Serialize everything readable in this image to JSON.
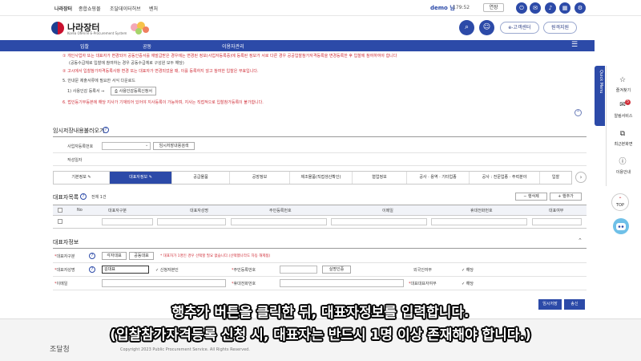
{
  "topbar": {
    "links": [
      "나라장터",
      "종합쇼핑몰",
      "조달데이터허브",
      "벤처"
    ],
    "user_name": "demo 님",
    "timer": "179:52",
    "extend_label": "연장",
    "icons": [
      "logout-icon",
      "mail-icon",
      "bell-icon",
      "grid-icon",
      "settings-icon"
    ]
  },
  "header": {
    "logo_text": "나라장터",
    "logo_sub": "Korea ON-line E-Procurement System",
    "buttons": {
      "customer_center": "e-고객센터",
      "remote_support": "원격지원"
    }
  },
  "nav": {
    "items": [
      "입찰",
      "공동",
      "이용자관리"
    ]
  },
  "notice": {
    "line1": "① 개인사업자 또는 대표자가 변경되어 공동인증서를 재발급받은 경우에는 변경된 정보(사업자등록증)에 등록된 정보가 서로 다른 경우 공공입찰참가자격등록을 변경등록한 후 입찰에 참여하여야 합니다",
    "line2": "(공동수급체로 입찰에 참여하는 경우 공동수급체로 구성원 모두 해당)",
    "line3": "② 고시에서 입찰참가자격등록사항 변경 또는 대표자가 변경되었을 때, 이를 등록하지 않고 참여한 입찰은 무효입니다.",
    "line4": "5. 안내문 제출서류에 필요한 서식 다운로드",
    "line5_label": "1) 사용인감 등록서 ⇒",
    "line5_button": "사용인감등록신청서",
    "line6": "6. 법인등기부등본에 해당 지사가 기재되어 있어야 지사등록이 가능하며, 지사는 직접적으로 입찰참가등록이 불가합니다."
  },
  "temp_load": {
    "title": "임시저장내용불러오기",
    "biz_no_label": "사업자등록번호",
    "biz_no_value": "",
    "search_button": "임시저장내용검색",
    "writer_label": "작성일자"
  },
  "tabs": [
    {
      "label": "기본정보"
    },
    {
      "label": "대표자정보",
      "active": true
    },
    {
      "label": "공급물품"
    },
    {
      "label": "공장정보"
    },
    {
      "label": "제조물품(직접생산확인)"
    },
    {
      "label": "협업정보"
    },
    {
      "label": "공사 · 용역 · 기타업종"
    },
    {
      "label": "공사 : 전문업종 · 주력분야"
    },
    {
      "label": "입찰"
    }
  ],
  "rep_list": {
    "title": "대표자목록",
    "count": "전체 1건",
    "delete_row": "행삭제",
    "add_row": "행추가",
    "columns": [
      "No",
      "대표자구분",
      "대표자성명",
      "주민등록번호",
      "이메일",
      "휴대전화번호",
      "대표여부"
    ]
  },
  "rep_detail": {
    "title": "대표자정보",
    "type_label": "대표자구분",
    "type_btn1": "각자대표",
    "type_btn2": "공동대표",
    "type_note": "* 대표자가 1명인 경우 선택할 필요 없습니다.(선택했나라도 자동 해제됨)",
    "name_label": "대표자성명",
    "name_value": "김대표",
    "self_check": "신청자본인",
    "rrn_label": "주민등록번호",
    "rrn_button": "실명인증",
    "foreigner_label": "외국인여부",
    "foreigner_check": "해당",
    "email_label": "이메일",
    "phone_label": "휴대전화번호",
    "main_label": "대표대표자여부",
    "main_check": "해당"
  },
  "actions": {
    "temp_save": "임시저장",
    "send": "송신"
  },
  "footer": {
    "logo": "조달청",
    "copyright": "Copyright 2023 Public Procurement Service. All Rights Reserved."
  },
  "subtitles": {
    "line1": "행추가 버튼을 클릭한 뒤, 대표자정보를 입력합니다.",
    "line2": "(입찰참가자격등록 신청 시, 대표자는 반드시 1명 이상 존재해야 합니다.)"
  },
  "side_panel": {
    "quick_menu": "Quick Menu",
    "items": [
      "즐겨찾기",
      "알림서비스",
      "최근본화면",
      "이용안내"
    ],
    "alert_count": "5",
    "top_label": "TOP"
  },
  "colors": {
    "primary": "#2c4aa8",
    "warning_red": "#d0303a"
  }
}
